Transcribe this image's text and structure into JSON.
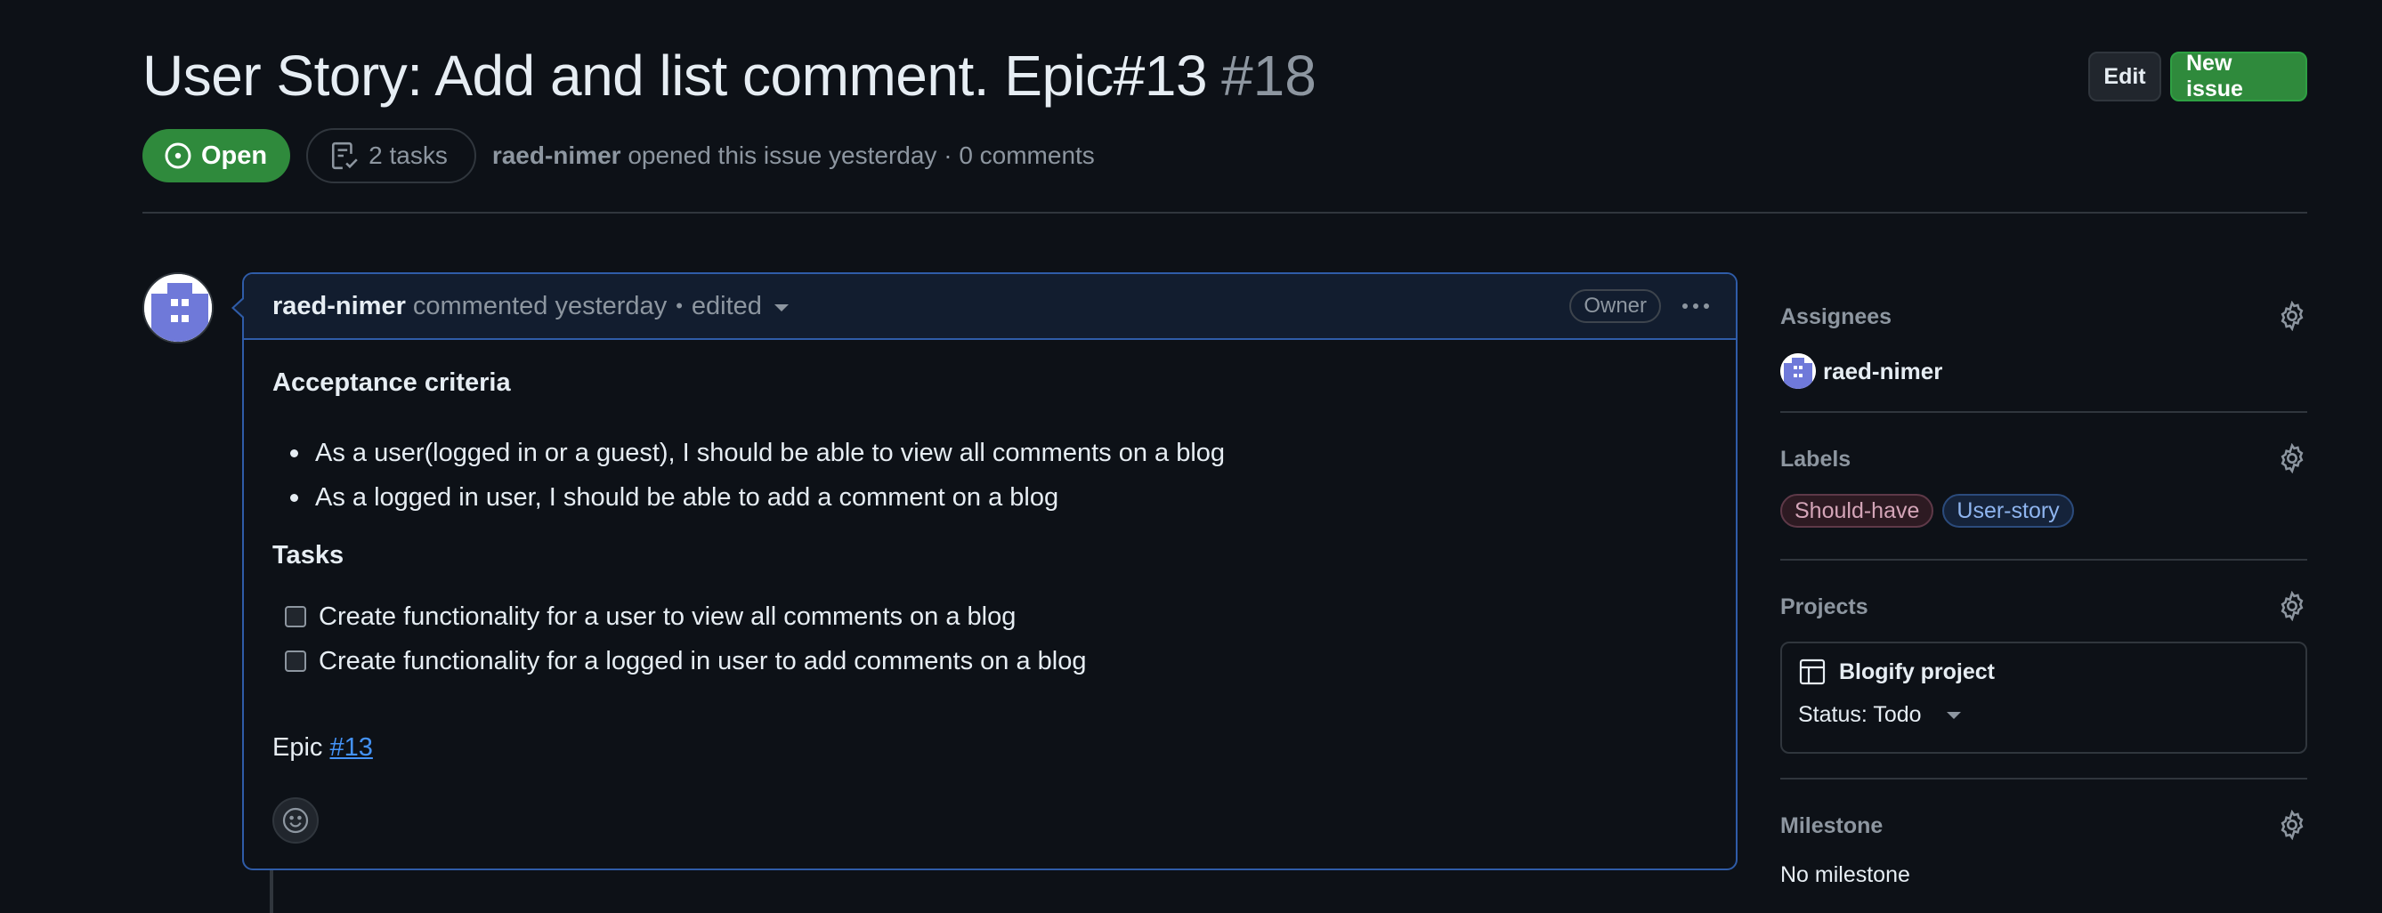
{
  "issue": {
    "title": "User Story: Add and list comment. Epic#13",
    "number": "#18",
    "state": "Open",
    "tasks": "2 tasks",
    "author": "raed-nimer",
    "meta": "opened this issue yesterday · 0 comments"
  },
  "header_actions": {
    "edit_label": "Edit",
    "new_issue_label": "New issue"
  },
  "comment": {
    "author": "raed-nimer",
    "when": "commented yesterday",
    "separator": "•",
    "edited": "edited",
    "badge": "Owner",
    "heading_acceptance": "Acceptance criteria",
    "acceptance": [
      "As a user(logged in or a guest), I should be able to view all comments on a blog",
      "As a logged in user, I should be able to add a comment on a blog"
    ],
    "heading_tasks": "Tasks",
    "tasks": [
      "Create functionality for a user to view all comments on a blog",
      "Create functionality for a logged in user to add comments on a blog"
    ],
    "epic_prefix": "Epic",
    "epic_link": "#13"
  },
  "sidebar": {
    "assignees_title": "Assignees",
    "assignee": "raed-nimer",
    "labels_title": "Labels",
    "labels": [
      "Should-have",
      "User-story"
    ],
    "projects_title": "Projects",
    "project_name": "Blogify project",
    "project_status": "Status: Todo",
    "milestone_title": "Milestone",
    "milestone_value": "No milestone"
  },
  "colors": {
    "open_green": "#2f8a3c",
    "link_blue": "#4493f8",
    "border_blue": "#2f5ca8",
    "muted": "#8d96a0"
  }
}
